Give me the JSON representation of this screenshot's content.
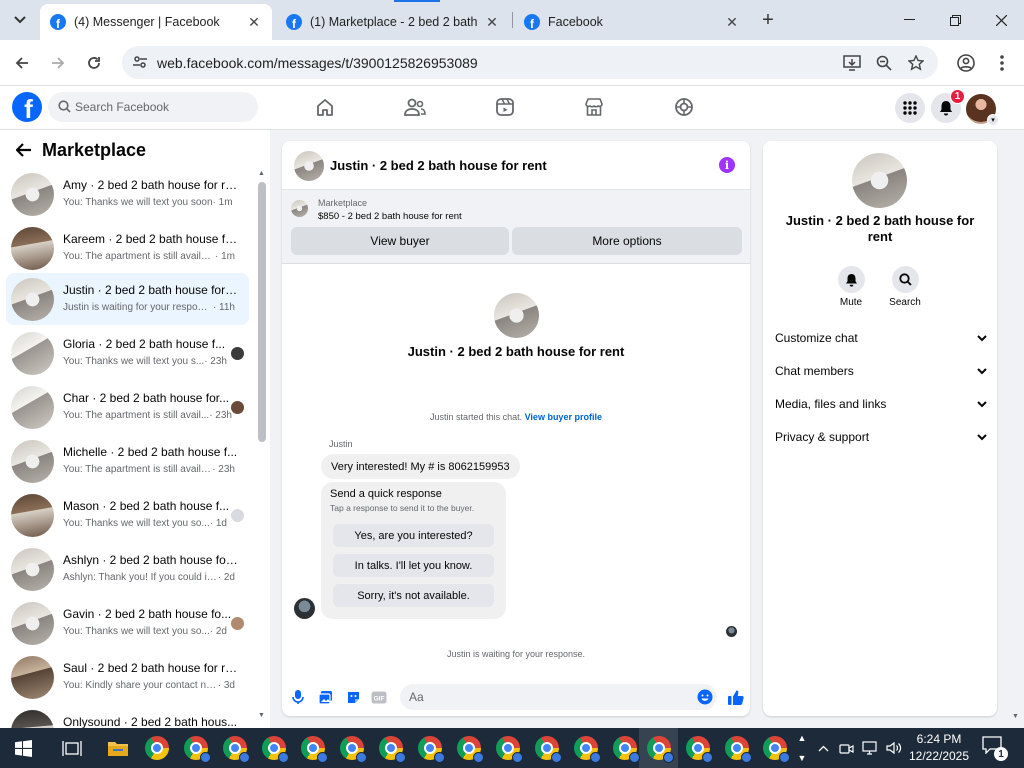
{
  "browser": {
    "tabs": [
      {
        "title": "(4) Messenger | Facebook",
        "active": true
      },
      {
        "title": "(1) Marketplace - 2 bed 2 bath h",
        "active": false
      },
      {
        "title": "Facebook",
        "active": false
      }
    ],
    "favicon_letter": "f",
    "url": "web.facebook.com/messages/t/3900125826953089"
  },
  "fb": {
    "logo_letter": "f",
    "search_placeholder": "Search Facebook",
    "notification_count": "1",
    "brand_color": "#0866ff"
  },
  "left": {
    "title": "Marketplace",
    "conversations": [
      {
        "title": "Amy · 2 bed 2 bath house for re...",
        "snippet": "You: Thanks we will text you soon",
        "time": " · 1m"
      },
      {
        "title": "Kareem · 2 bed 2 bath house fo...",
        "snippet": "You: The apartment is still availabl...",
        "time": " · 1m"
      },
      {
        "title": "Justin · 2 bed 2 bath house for r...",
        "snippet": "Justin is waiting for your response.",
        "time": " · 11h"
      },
      {
        "title": "Gloria · 2 bed 2 bath house f...",
        "snippet": "You: Thanks we will text you s...",
        "time": " · 23h"
      },
      {
        "title": "Char · 2 bed 2 bath house for...",
        "snippet": "You: The apartment is still avail...",
        "time": " · 23h"
      },
      {
        "title": "Michelle · 2 bed 2 bath house f...",
        "snippet": "You: The apartment is still availab...",
        "time": " · 23h"
      },
      {
        "title": "Mason · 2 bed 2 bath house f...",
        "snippet": "You: Thanks we will text you so...",
        "time": " · 1d"
      },
      {
        "title": "Ashlyn · 2 bed 2 bath house for...",
        "snippet": "Ashlyn: Thank you! If you could inc...",
        "time": " · 2d"
      },
      {
        "title": "Gavin · 2 bed 2 bath house fo...",
        "snippet": "You: Thanks we will text you so...",
        "time": " · 2d"
      },
      {
        "title": "Saul · 2 bed 2 bath house for rent",
        "snippet": "You: Kindly share your contact nu...",
        "time": " · 3d"
      },
      {
        "title": "Onlysound · 2 bed 2 bath hous...",
        "snippet": "",
        "time": ""
      }
    ]
  },
  "chat": {
    "header_title": "Justin · 2 bed 2 bath house for rent",
    "marketplace_label": "Marketplace",
    "marketplace_item": "$850 - 2 bed 2 bath house for rent",
    "view_buyer": "View buyer",
    "more_options": "More options",
    "intro_name": "Justin · 2 bed 2 bath house for rent",
    "started_text": "Justin started this chat. ",
    "view_buyer_profile": "View buyer profile",
    "sender_name": "Justin",
    "message": "Very interested! My # is 8062159953",
    "quick_title": "Send a quick response",
    "quick_sub": "Tap a response to send it to the buyer.",
    "quick_responses": [
      "Yes, are you interested?",
      "In talks. I'll let you know.",
      "Sorry, it's not available."
    ],
    "waiting_text": "Justin is waiting for your response.",
    "composer_placeholder": "Aa",
    "gif_label": "GIF"
  },
  "right": {
    "name": "Justin · 2 bed 2 bath house for rent",
    "mute": "Mute",
    "search": "Search",
    "rows": [
      "Customize chat",
      "Chat members",
      "Media, files and links",
      "Privacy & support"
    ]
  },
  "taskbar": {
    "time": "6:24 PM",
    "date": "12/22/2025",
    "notification_count": "1"
  }
}
